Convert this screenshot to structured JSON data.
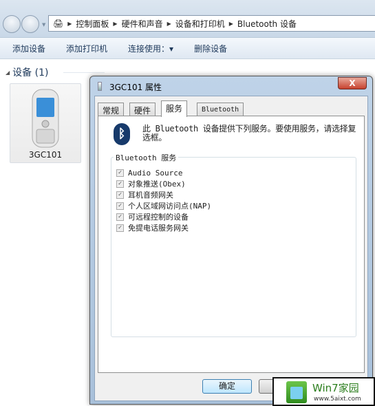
{
  "explorer": {
    "breadcrumb": [
      "控制面板",
      "硬件和声音",
      "设备和打印机",
      "Bluetooth 设备"
    ],
    "toolbar": [
      "添加设备",
      "添加打印机",
      "连接使用：▾",
      "删除设备"
    ],
    "group_header": "设备 (1)",
    "device": {
      "name": "3GC101",
      "icon": "mobile-phone-icon"
    }
  },
  "dialog": {
    "title": "3GC101 属性",
    "close": "X",
    "tabs": [
      "常规",
      "硬件",
      "服务",
      "Bluetooth"
    ],
    "active_tab": "服务",
    "description": "此 Bluetooth 设备提供下列服务。要使用服务，请选择复选框。",
    "group_label": "Bluetooth 服务",
    "services": [
      {
        "label": "Audio Source",
        "checked": true
      },
      {
        "label": "对象推送(Obex)",
        "checked": true
      },
      {
        "label": "耳机音频网关",
        "checked": true
      },
      {
        "label": "个人区域网访问点(NAP)",
        "checked": true
      },
      {
        "label": "可远程控制的设备",
        "checked": true
      },
      {
        "label": "免提电话服务网关",
        "checked": true
      }
    ],
    "ok": "确定"
  },
  "watermark": {
    "title": "Win7家园",
    "url": "www.5aixt.com"
  }
}
